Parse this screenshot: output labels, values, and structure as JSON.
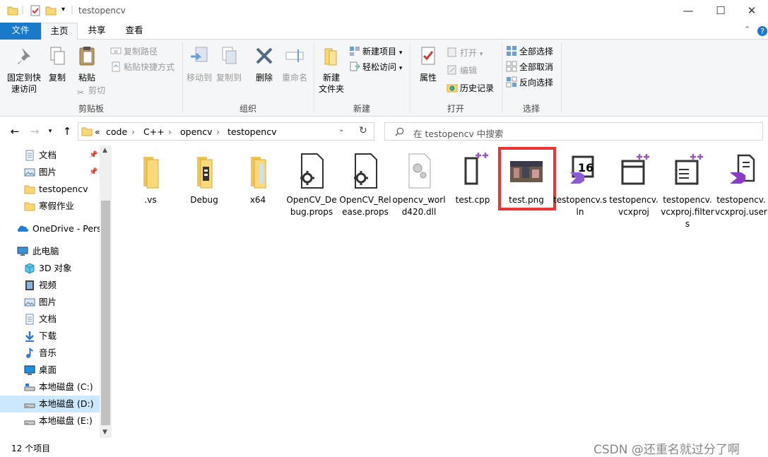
{
  "window": {
    "title": "testopencv",
    "controls": {
      "minimize": "—",
      "maximize": "☐",
      "close": "✕"
    }
  },
  "ribbon_tabs": [
    "文件",
    "主页",
    "共享",
    "查看"
  ],
  "ribbon": {
    "clipboard": {
      "pin": "固定到快\n速访问",
      "copy": "复制",
      "paste": "粘贴",
      "copy_path": "复制路径",
      "paste_shortcut": "粘贴快捷方式",
      "cut": "剪切",
      "group_label": "剪贴板"
    },
    "organize": {
      "move_to": "移动到",
      "copy_to": "复制到",
      "delete": "删除",
      "rename": "重命名",
      "group_label": "组织"
    },
    "new": {
      "new_folder": "新建\n文件夹",
      "new_item": "新建项目",
      "easy_access": "轻松访问",
      "group_label": "新建"
    },
    "open": {
      "properties": "属性",
      "open": "打开",
      "edit": "编辑",
      "history": "历史记录",
      "group_label": "打开"
    },
    "select": {
      "select_all": "全部选择",
      "select_none": "全部取消",
      "invert": "反向选择",
      "group_label": "选择"
    }
  },
  "address": {
    "crumbs": [
      "«",
      "code",
      "C++",
      "opencv",
      "testopencv"
    ],
    "search_placeholder": "在 testopencv 中搜索"
  },
  "nav": {
    "items": [
      {
        "label": "文档",
        "icon": "document-icon",
        "pinned": true
      },
      {
        "label": "图片",
        "icon": "pictures-icon",
        "pinned": true
      },
      {
        "label": "testopencv",
        "icon": "folder-icon"
      },
      {
        "label": "寒假作业",
        "icon": "folder-icon"
      },
      {
        "label": "OneDrive - Perso",
        "icon": "onedrive-icon"
      },
      {
        "label": "此电脑",
        "icon": "computer-icon"
      },
      {
        "label": "3D 对象",
        "icon": "3d-objects-icon"
      },
      {
        "label": "视频",
        "icon": "video-icon"
      },
      {
        "label": "图片",
        "icon": "pictures-icon"
      },
      {
        "label": "文档",
        "icon": "document-icon"
      },
      {
        "label": "下载",
        "icon": "download-icon"
      },
      {
        "label": "音乐",
        "icon": "music-icon"
      },
      {
        "label": "桌面",
        "icon": "desktop-icon"
      },
      {
        "label": "本地磁盘 (C:)",
        "icon": "drive-c-icon"
      },
      {
        "label": "本地磁盘 (D:)",
        "icon": "drive-d-icon",
        "selected": true
      },
      {
        "label": "本地磁盘 (E:)",
        "icon": "drive-e-icon"
      }
    ]
  },
  "files": [
    {
      "name": ".vs",
      "icon": "folder-icon"
    },
    {
      "name": "Debug",
      "icon": "folder-icon"
    },
    {
      "name": "x64",
      "icon": "folder-icon"
    },
    {
      "name": "OpenCV_Debug.props",
      "icon": "props-icon"
    },
    {
      "name": "OpenCV_Release.props",
      "icon": "props-icon"
    },
    {
      "name": "opencv_world420.dll",
      "icon": "dll-icon"
    },
    {
      "name": "test.cpp",
      "icon": "cpp-icon"
    },
    {
      "name": "test.png",
      "icon": "image-thumbnail-icon",
      "highlighted": true
    },
    {
      "name": "testopencv.sln",
      "icon": "vs-solution-icon"
    },
    {
      "name": "testopencv.vcxproj",
      "icon": "vcxproj-icon"
    },
    {
      "name": "testopencv.vcxproj.filters",
      "icon": "vcxproj-filters-icon"
    },
    {
      "name": "testopencv.vcxproj.user",
      "icon": "vs-user-icon"
    }
  ],
  "status": {
    "count": "12 个项目",
    "watermark": "CSDN @还重名就过分了啊"
  },
  "colors": {
    "accent": "#1979ca",
    "folder": "#f8d775",
    "highlight": "#e33333",
    "selection": "#cce8ff"
  }
}
